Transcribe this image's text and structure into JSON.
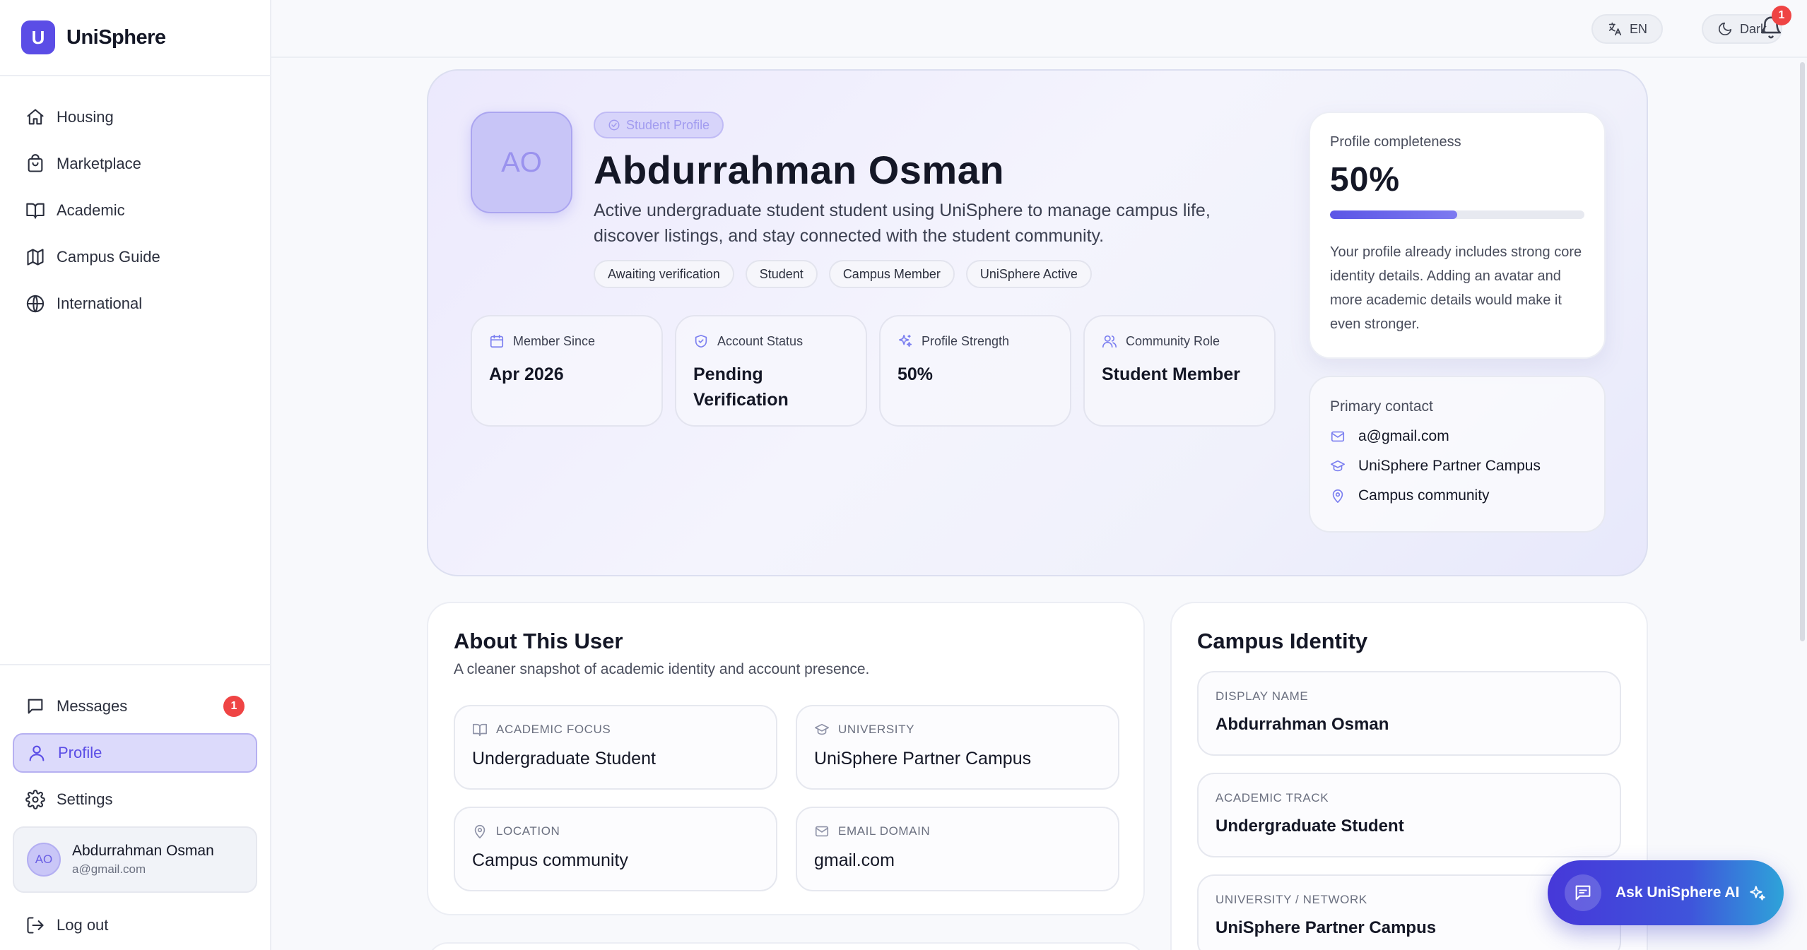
{
  "app": {
    "logo_letter": "U",
    "name": "UniSphere"
  },
  "sidebar": {
    "nav": [
      {
        "label": "Housing",
        "icon": "home-icon"
      },
      {
        "label": "Marketplace",
        "icon": "shopping-bag-icon"
      },
      {
        "label": "Academic",
        "icon": "book-icon"
      },
      {
        "label": "Campus Guide",
        "icon": "map-icon"
      },
      {
        "label": "International",
        "icon": "globe-icon"
      }
    ],
    "bottom": {
      "messages_label": "Messages",
      "messages_badge": "1",
      "profile_label": "Profile",
      "settings_label": "Settings",
      "logout_label": "Log out"
    },
    "user": {
      "initials": "AO",
      "name": "Abdurrahman Osman",
      "email": "a@gmail.com"
    }
  },
  "topbar": {
    "language_label": "EN",
    "theme_label": "Dark",
    "notifications_badge": "1"
  },
  "hero": {
    "initials": "AO",
    "tag": "Student Profile",
    "name": "Abdurrahman Osman",
    "description": "Active undergraduate student student using UniSphere to manage campus life, discover listings, and stay connected with the student community.",
    "chips": [
      "Awaiting verification",
      "Student",
      "Campus Member",
      "UniSphere Active"
    ],
    "stats": [
      {
        "label": "Member Since",
        "value": "Apr 2026",
        "icon": "calendar-icon"
      },
      {
        "label": "Account Status",
        "value": "Pending Verification",
        "icon": "shield-check-icon"
      },
      {
        "label": "Profile Strength",
        "value": "50%",
        "icon": "sparkles-icon"
      },
      {
        "label": "Community Role",
        "value": "Student Member",
        "icon": "users-icon"
      }
    ],
    "completeness": {
      "label": "Profile completeness",
      "value": "50%",
      "progress": 0.5,
      "description": "Your profile already includes strong core identity details. Adding an avatar and more academic details would make it even stronger."
    },
    "contact": {
      "label": "Primary contact",
      "items": [
        {
          "text": "a@gmail.com",
          "icon": "mail-icon"
        },
        {
          "text": "UniSphere Partner Campus",
          "icon": "graduation-cap-icon"
        },
        {
          "text": "Campus community",
          "icon": "map-pin-icon"
        }
      ]
    }
  },
  "about": {
    "title": "About This User",
    "subtitle": "A cleaner snapshot of academic identity and account presence.",
    "items": [
      {
        "label": "ACADEMIC FOCUS",
        "value": "Undergraduate Student",
        "icon": "book-icon"
      },
      {
        "label": "UNIVERSITY",
        "value": "UniSphere Partner Campus",
        "icon": "graduation-cap-icon"
      },
      {
        "label": "LOCATION",
        "value": "Campus community",
        "icon": "map-pin-icon"
      },
      {
        "label": "EMAIL DOMAIN",
        "value": "gmail.com",
        "icon": "mail-icon"
      }
    ]
  },
  "identity": {
    "title": "Campus Identity",
    "items": [
      {
        "label": "DISPLAY NAME",
        "value": "Abdurrahman Osman"
      },
      {
        "label": "ACADEMIC TRACK",
        "value": "Undergraduate Student"
      },
      {
        "label": "UNIVERSITY / NETWORK",
        "value": "UniSphere Partner Campus"
      }
    ]
  },
  "ask_ai": {
    "label": "Ask UniSphere AI"
  },
  "colors": {
    "accent": "#5b4de6",
    "badge": "#ef4444"
  }
}
